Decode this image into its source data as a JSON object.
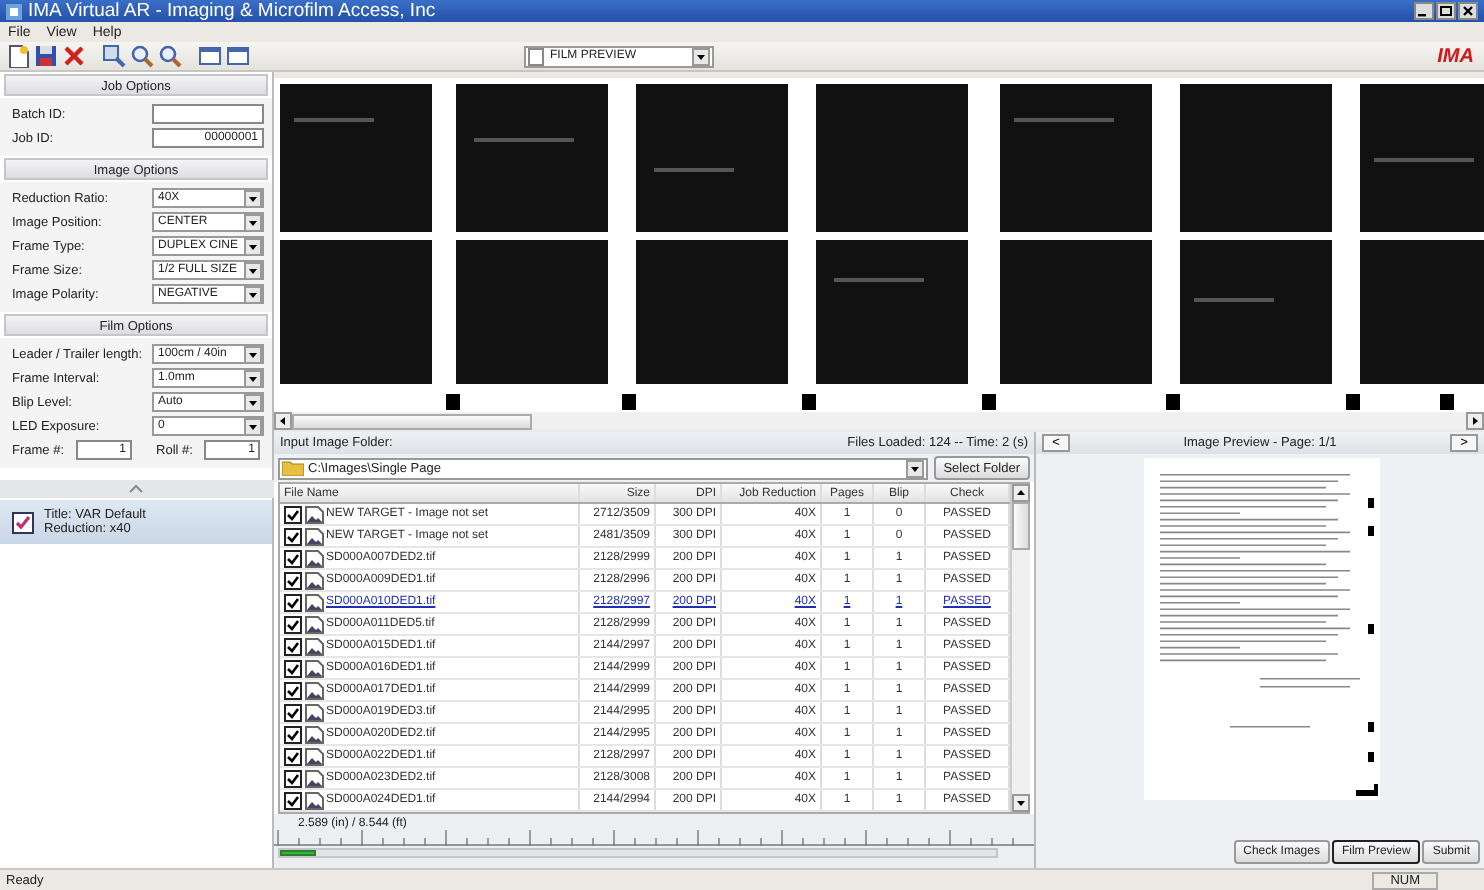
{
  "window": {
    "title": "IMA Virtual AR - Imaging & Microfilm Access, Inc"
  },
  "menu": [
    "File",
    "View",
    "Help"
  ],
  "toolbar": {
    "view_select": "FILM PREVIEW",
    "logo": "IMA"
  },
  "sections": [
    {
      "title": "Job Options",
      "fields": [
        {
          "kind": "text",
          "label": "Batch ID:"
        },
        {
          "kind": "text",
          "label": "Job ID:",
          "value": "00000001"
        }
      ]
    },
    {
      "title": "Image Options",
      "fields": [
        {
          "kind": "select",
          "label": "Reduction Ratio:",
          "value": "40X"
        },
        {
          "kind": "select",
          "label": "Image Position:",
          "value": "CENTER"
        },
        {
          "kind": "select",
          "label": "Frame Type:",
          "value": "DUPLEX CINE"
        },
        {
          "kind": "select",
          "label": "Frame Size:",
          "value": "1/2 FULL SIZE"
        },
        {
          "kind": "select",
          "label": "Image Polarity:",
          "value": "NEGATIVE"
        }
      ]
    },
    {
      "title": "Film Options",
      "fields": [
        {
          "kind": "select",
          "label": "Leader / Trailer length:",
          "value": "100cm / 40in"
        },
        {
          "kind": "select",
          "label": "Frame Interval:",
          "value": "1.0mm"
        },
        {
          "kind": "select",
          "label": "Blip Level:",
          "value": "Auto"
        },
        {
          "kind": "select",
          "label": "LED Exposure:",
          "value": "0"
        },
        {
          "kind": "pair",
          "items": [
            {
              "label": "Frame #:",
              "value": "1"
            },
            {
              "label": "Roll #:",
              "value": "1"
            }
          ]
        }
      ]
    }
  ],
  "profiles": [
    {
      "title": "Title: VAR Default",
      "reduction": "Reduction: x40",
      "checked": true
    }
  ],
  "files": {
    "folder_label": "Input Image Folder:",
    "status": "Files Loaded: 124 -- Time: 2 (s)",
    "path": "C:\\Images\\Single Page",
    "select_button": "Select Folder",
    "columns": [
      "File Name",
      "Size",
      "DPI",
      "Job Reduction",
      "Pages",
      "Blip",
      "Check"
    ],
    "rows": [
      {
        "checked": true,
        "selected": false,
        "cells": [
          "NEW TARGET - Image not set",
          "2712/3509",
          "300 DPI",
          "40X",
          "1",
          "0",
          "PASSED"
        ]
      },
      {
        "checked": true,
        "selected": false,
        "cells": [
          "NEW TARGET - Image not set",
          "2481/3509",
          "300 DPI",
          "40X",
          "1",
          "0",
          "PASSED"
        ]
      },
      {
        "checked": true,
        "selected": false,
        "cells": [
          "SD000A007DED2.tif",
          "2128/2999",
          "200 DPI",
          "40X",
          "1",
          "1",
          "PASSED"
        ]
      },
      {
        "checked": true,
        "selected": false,
        "cells": [
          "SD000A009DED1.tif",
          "2128/2996",
          "200 DPI",
          "40X",
          "1",
          "1",
          "PASSED"
        ]
      },
      {
        "checked": true,
        "selected": true,
        "cells": [
          "SD000A010DED1.tif",
          "2128/2997",
          "200 DPI",
          "40X",
          "1",
          "1",
          "PASSED"
        ]
      },
      {
        "checked": true,
        "selected": false,
        "cells": [
          "SD000A011DED5.tif",
          "2128/2999",
          "200 DPI",
          "40X",
          "1",
          "1",
          "PASSED"
        ]
      },
      {
        "checked": true,
        "selected": false,
        "cells": [
          "SD000A015DED1.tif",
          "2144/2997",
          "200 DPI",
          "40X",
          "1",
          "1",
          "PASSED"
        ]
      },
      {
        "checked": true,
        "selected": false,
        "cells": [
          "SD000A016DED1.tif",
          "2144/2999",
          "200 DPI",
          "40X",
          "1",
          "1",
          "PASSED"
        ]
      },
      {
        "checked": true,
        "selected": false,
        "cells": [
          "SD000A017DED1.tif",
          "2144/2999",
          "200 DPI",
          "40X",
          "1",
          "1",
          "PASSED"
        ]
      },
      {
        "checked": true,
        "selected": false,
        "cells": [
          "SD000A019DED3.tif",
          "2144/2995",
          "200 DPI",
          "40X",
          "1",
          "1",
          "PASSED"
        ]
      },
      {
        "checked": true,
        "selected": false,
        "cells": [
          "SD000A020DED2.tif",
          "2144/2995",
          "200 DPI",
          "40X",
          "1",
          "1",
          "PASSED"
        ]
      },
      {
        "checked": true,
        "selected": false,
        "cells": [
          "SD000A022DED1.tif",
          "2128/2997",
          "200 DPI",
          "40X",
          "1",
          "1",
          "PASSED"
        ]
      },
      {
        "checked": true,
        "selected": false,
        "cells": [
          "SD000A023DED2.tif",
          "2128/3008",
          "200 DPI",
          "40X",
          "1",
          "1",
          "PASSED"
        ]
      },
      {
        "checked": true,
        "selected": false,
        "cells": [
          "SD000A024DED1.tif",
          "2144/2994",
          "200 DPI",
          "40X",
          "1",
          "1",
          "PASSED"
        ]
      }
    ]
  },
  "ruler": {
    "reading": "2.589 (in) / 8.544 (ft)",
    "level": 0.05
  },
  "preview": {
    "prev": "<",
    "title": "Image Preview - Page: 1/1",
    "next": ">"
  },
  "buttons": [
    {
      "label": "Check Images",
      "selected": false
    },
    {
      "label": "Film Preview",
      "selected": true
    },
    {
      "label": "Submit",
      "selected": false
    }
  ],
  "status_bar": {
    "text": "Ready",
    "indicator": "NUM"
  }
}
